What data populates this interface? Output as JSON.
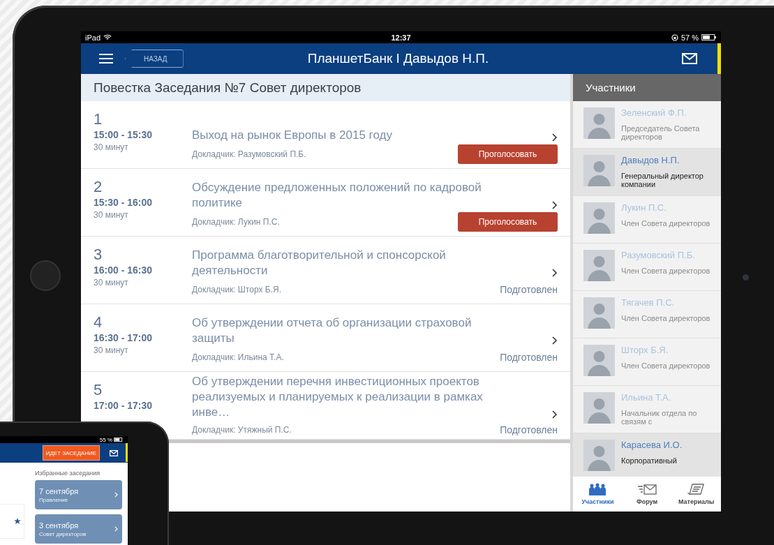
{
  "status_bar": {
    "device": "iPad",
    "time": "12:37",
    "battery": "57 %"
  },
  "nav": {
    "back": "НАЗАД",
    "title": "ПланшетБанк I Давыдов Н.П."
  },
  "agenda": {
    "title": "Повестка Заседания №7 Совет директоров",
    "items": [
      {
        "number": "1",
        "time": "15:00 - 15:30",
        "duration": "30 минут",
        "title": "Выход на рынок Европы в 2015 году",
        "speaker": "Докладчик: Разумовский П.Б.",
        "status": {
          "kind": "button",
          "text": "Проголосовать"
        }
      },
      {
        "number": "2",
        "time": "15:30 - 16:00",
        "duration": "30 минут",
        "title": "Обсуждение предложенных положений по кадровой политике",
        "speaker": "Докладчик: Лукин П.С.",
        "status": {
          "kind": "button",
          "text": "Проголосовать"
        }
      },
      {
        "number": "3",
        "time": "16:00 - 16:30",
        "duration": "30 минут",
        "title": "Программа благотворительной и спонсорской деятельности",
        "speaker": "Докладчик: Шторх Б.Я.",
        "status": {
          "kind": "label",
          "text": "Подготовлен"
        }
      },
      {
        "number": "4",
        "time": "16:30 - 17:00",
        "duration": "30 минут",
        "title": "Об утверждении отчета об организации страховой защиты",
        "speaker": "Докладчик: Ильина Т.А.",
        "status": {
          "kind": "label",
          "text": "Подготовлен"
        }
      },
      {
        "number": "5",
        "time": "17:00 - 17:30",
        "title": "Об утверждении перечня инвестиционных проектов реализуемых и планируемых к реализации в рамках инве…",
        "speaker": "Докладчик: Утяжный П.С.",
        "status": {
          "kind": "label",
          "text": "Подготовлен"
        }
      }
    ]
  },
  "participants": {
    "title": "Участники",
    "items": [
      {
        "name": "Зеленский Ф.П.",
        "role": "Председатель Совета директоров",
        "selected": false
      },
      {
        "name": "Давыдов Н.П.",
        "role": "Генеральный директор компании",
        "selected": true
      },
      {
        "name": "Лукин П.С.",
        "role": "Член Совета директоров",
        "selected": false
      },
      {
        "name": "Разумовский П.Б.",
        "role": "Член Совета директоров",
        "selected": false
      },
      {
        "name": "Тягачев П.С.",
        "role": "Член Совета директоров",
        "selected": false
      },
      {
        "name": "Шторх Б.Я.",
        "role": "Член Совета директоров",
        "selected": false
      },
      {
        "name": "Ильина Т.А.",
        "role": "Начальник отдела по связям с",
        "selected": false
      },
      {
        "name": "Карасева И.О.",
        "role": "Корпоративный",
        "selected": true
      }
    ]
  },
  "tabs": [
    {
      "kind": "people",
      "label": "Участники",
      "selected": true
    },
    {
      "kind": "forum",
      "label": "Форум",
      "selected": false
    },
    {
      "kind": "materials",
      "label": "Материалы",
      "selected": false
    }
  ],
  "second_device": {
    "battery": "55 %",
    "badge": "ИДЕТ ЗАСЕДАНИЕ",
    "favorites_title": "Избранные заседания",
    "favorites": [
      {
        "date": "7 сентября",
        "name": "Правление"
      },
      {
        "date": "3 сентября",
        "name": "Совет директоров"
      }
    ]
  }
}
